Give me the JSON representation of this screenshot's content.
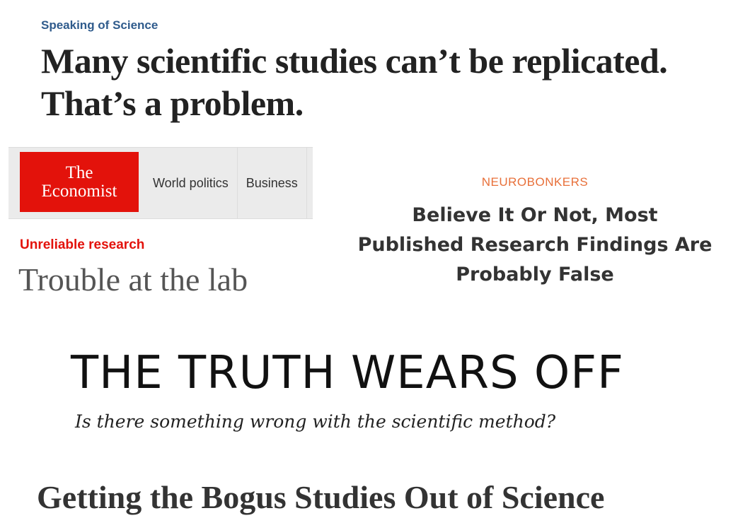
{
  "wapo": {
    "kicker": "Speaking of Science",
    "headline_line1": "Many scientific studies can’t be replicated.",
    "headline_line2": "That’s a problem."
  },
  "economist": {
    "logo_line1": "The",
    "logo_line2": "Economist",
    "nav_items": [
      "World politics",
      "Business"
    ],
    "kicker": "Unreliable research",
    "headline": "Trouble at the lab"
  },
  "neurobonkers": {
    "kicker": "NEUROBONKERS",
    "headline_line1": "Believe It Or Not, Most",
    "headline_line2": "Published Research Findings Are",
    "headline_line3": "Probably False"
  },
  "newyorker": {
    "headline": "THE TRUTH WEARS OFF",
    "subhead": "Is there something wrong with the scientific method?"
  },
  "bottom": {
    "headline": "Getting the Bogus Studies Out of Science"
  },
  "colors": {
    "wapo_kicker": "#2f5b8c",
    "economist_red": "#e3120b",
    "neuro_orange": "#e8703a"
  }
}
